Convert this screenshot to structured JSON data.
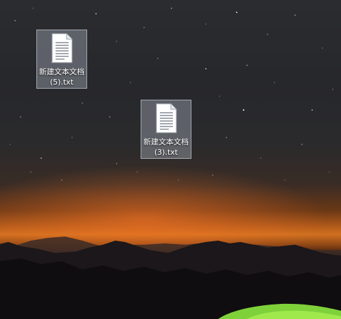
{
  "desktop": {
    "icons": [
      {
        "name_line1": "新建文本文档",
        "name_line2": "(5).txt",
        "selected": true
      },
      {
        "name_line1": "新建文本文档",
        "name_line2": "(3).txt",
        "selected": true
      }
    ]
  },
  "colors": {
    "sky": "#2a2a2c",
    "horizon_glow": "#d0701f",
    "mountains": "#16141a",
    "tent": "#8be03a",
    "selection": "#cdd7e6"
  }
}
